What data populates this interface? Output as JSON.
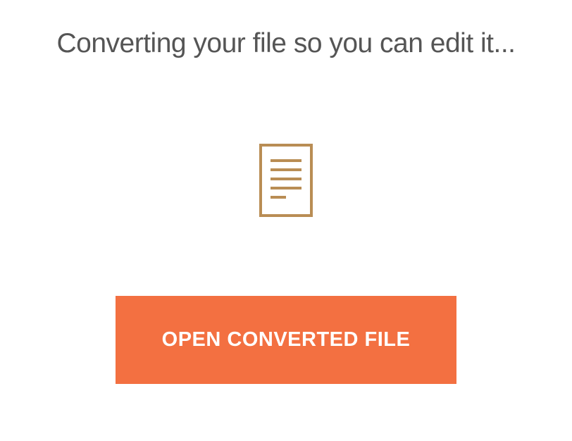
{
  "title": "Converting your file so you can edit it...",
  "icon": "document-icon",
  "button": {
    "label": "OPEN CONVERTED FILE"
  },
  "colors": {
    "accent": "#f37041",
    "iconStroke": "#b98d54",
    "titleText": "#555555"
  }
}
